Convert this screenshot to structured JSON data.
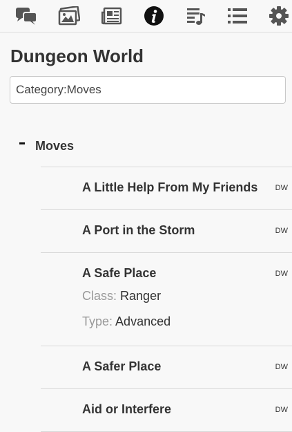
{
  "toolbar": {
    "buttons": [
      {
        "icon": "chat-icon"
      },
      {
        "icon": "gallery-icon"
      },
      {
        "icon": "article-icon"
      },
      {
        "icon": "info-icon"
      },
      {
        "icon": "playlist-icon"
      },
      {
        "icon": "list-icon"
      },
      {
        "icon": "settings-icon"
      }
    ]
  },
  "page": {
    "title": "Dungeon World"
  },
  "search": {
    "value": "Category:Moves"
  },
  "group": {
    "label": "Moves"
  },
  "moves": [
    {
      "name": "A Little Help From My Friends",
      "badge": "DW"
    },
    {
      "name": "A Port in the Storm",
      "badge": "DW"
    },
    {
      "name": "A Safe Place",
      "badge": "DW",
      "class_key": "Class:",
      "class_value": "Ranger",
      "type_key": "Type:",
      "type_value": "Advanced"
    },
    {
      "name": "A Safer Place",
      "badge": "DW"
    },
    {
      "name": "Aid or Interfere",
      "badge": "DW"
    }
  ],
  "colors": {
    "icon": "#555555",
    "info_active": "#111111",
    "text": "#333333",
    "muted": "#999999"
  }
}
